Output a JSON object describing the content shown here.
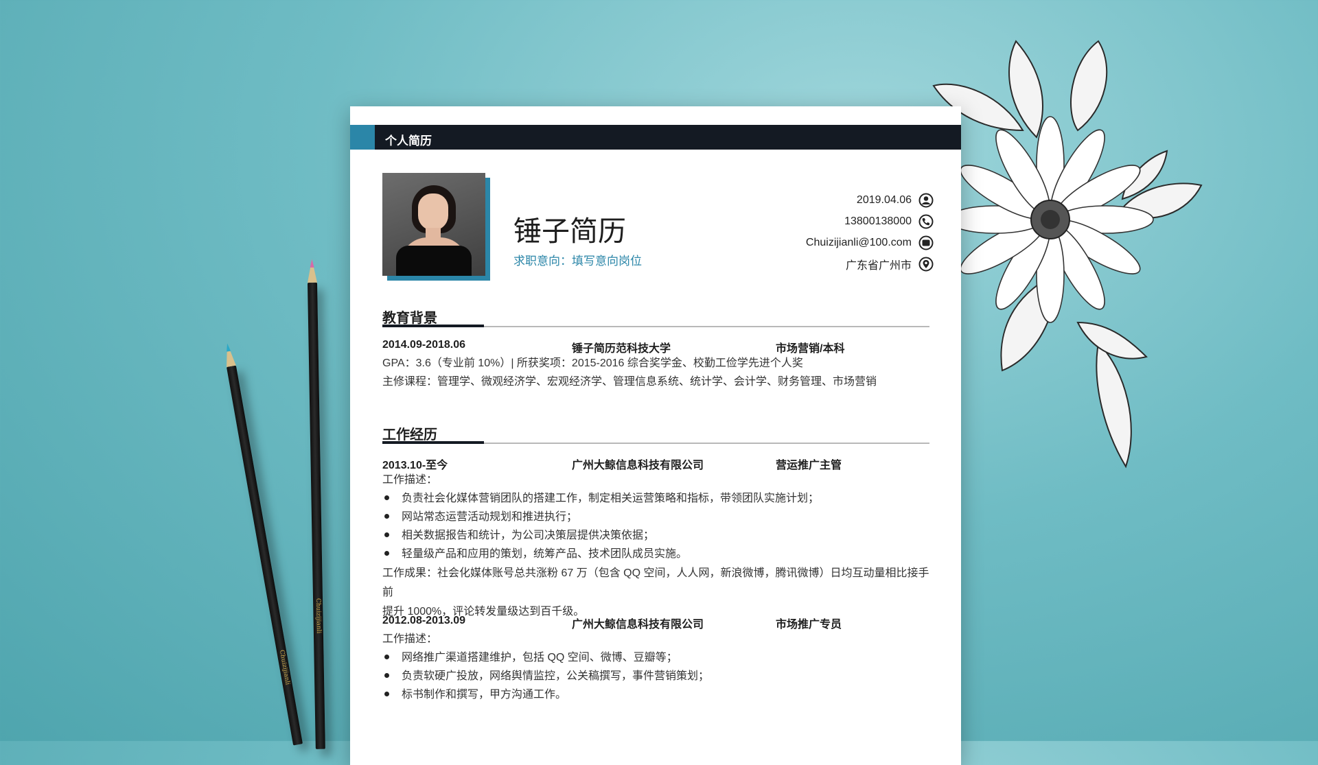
{
  "header_bar": {
    "label": "个人简历"
  },
  "profile": {
    "name": "锤子简历",
    "intent": "求职意向：填写意向岗位"
  },
  "contact": [
    {
      "text": "2019.04.06",
      "icon": "user-icon"
    },
    {
      "text": "13800138000",
      "icon": "phone-icon"
    },
    {
      "text": "Chuizijianli@100.com",
      "icon": "mail-icon"
    },
    {
      "text": "广东省广州市",
      "icon": "location-icon"
    }
  ],
  "education": {
    "title": "教育背景",
    "period": "2014.09-2018.06",
    "school": "锤子简历范科技大学",
    "major": "市场营销/本科",
    "gpa": "GPA：3.6（专业前 10%）| 所获奖项：2015-2016 综合奖学金、校勤工俭学先进个人奖",
    "courses": "主修课程：管理学、微观经济学、宏观经济学、管理信息系统、统计学、会计学、财务管理、市场营销"
  },
  "work": {
    "title": "工作经历",
    "jobs": [
      {
        "period": "2013.10-至今",
        "company": "广州大鲸信息科技有限公司",
        "role": "营运推广主管",
        "desc_label": "工作描述：",
        "bullets": [
          "负责社会化媒体营销团队的搭建工作，制定相关运营策略和指标，带领团队实施计划；",
          "网站常态运营活动规划和推进执行；",
          "相关数据报告和统计，为公司决策层提供决策依据；",
          "轻量级产品和应用的策划，统筹产品、技术团队成员实施。"
        ],
        "result_line1": "工作成果：社会化媒体账号总共涨粉 67 万（包含 QQ 空间，人人网，新浪微博，腾讯微博）日均互动量相比接手前",
        "result_line2": "提升 1000%，评论转发量级达到百千级。"
      },
      {
        "period": "2012.08-2013.09",
        "company": "广州大鲸信息科技有限公司",
        "role": "市场推广专员",
        "desc_label": "工作描述：",
        "bullets": [
          "网络推广渠道搭建维护，包括 QQ 空间、微博、豆瓣等；",
          "负责软硬广投放，网络舆情监控，公关稿撰写，事件营销策划；",
          "标书制作和撰写，甲方沟通工作。"
        ]
      }
    ]
  },
  "colors": {
    "accent": "#2b86a8",
    "dark_bar": "#141a23",
    "background": "#6fbcc4"
  }
}
